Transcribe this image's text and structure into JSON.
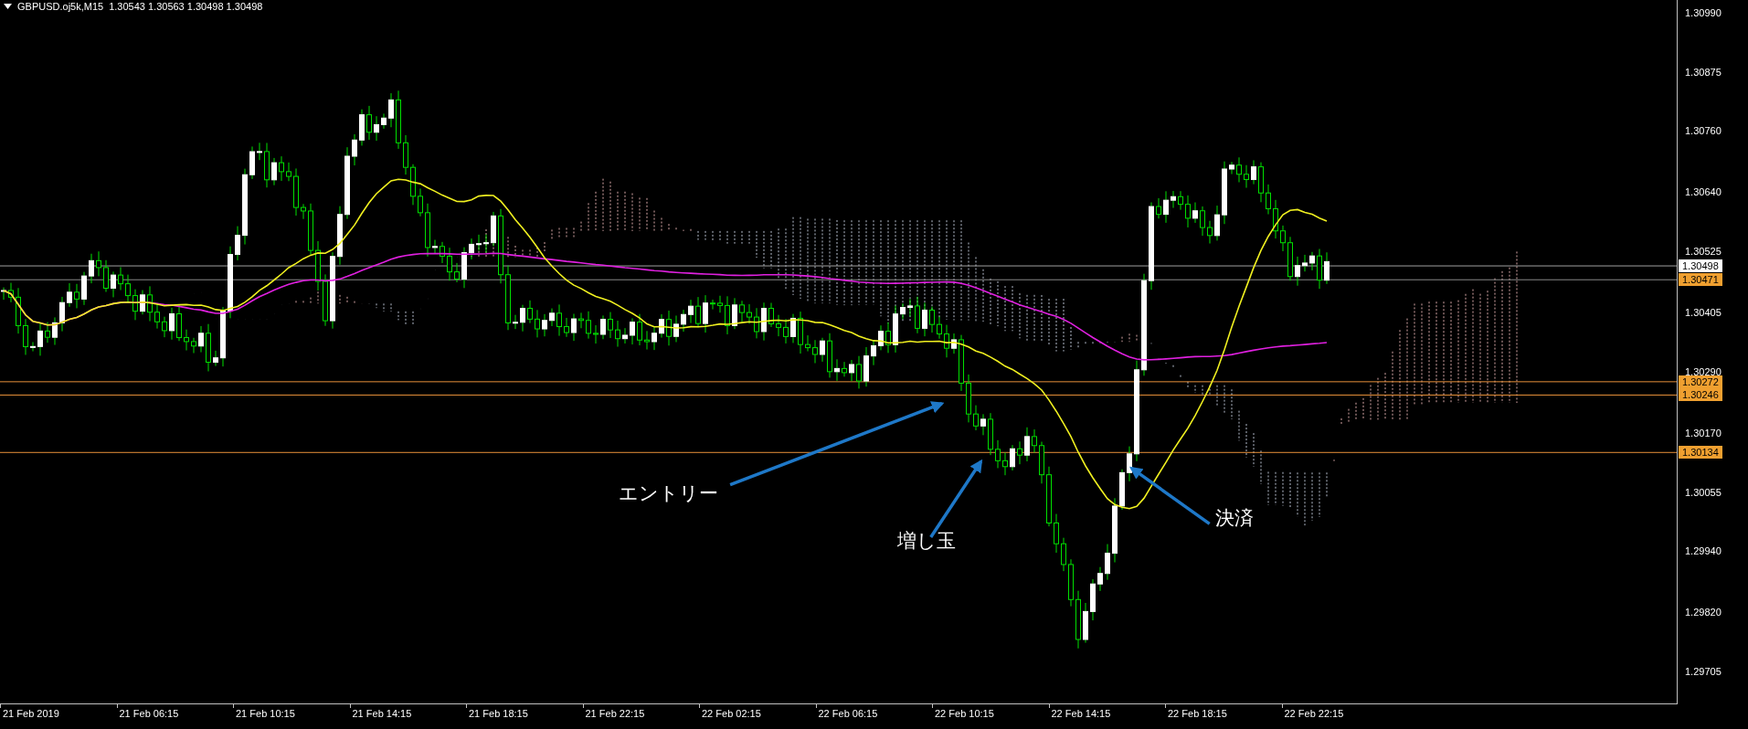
{
  "chart": {
    "header": {
      "symbol": "GBPUSD.oj5k,M15",
      "prices": "1.30543 1.30563 1.30498 1.30498"
    },
    "price_axis": [
      "1.30990",
      "1.30875",
      "1.30760",
      "1.30640",
      "1.30525",
      "1.30405",
      "1.30290",
      "1.30170",
      "1.30055",
      "1.29940",
      "1.29820",
      "1.29705"
    ],
    "price_markers": [
      {
        "label": "1.30498",
        "kind": "bid"
      },
      {
        "label": "1.30471",
        "kind": "ask"
      },
      {
        "label": "1.30272",
        "kind": "level"
      },
      {
        "label": "1.30246",
        "kind": "level"
      },
      {
        "label": "1.30134",
        "kind": "level"
      }
    ],
    "time_axis": [
      "21 Feb 2019",
      "21 Feb 06:15",
      "21 Feb 10:15",
      "21 Feb 14:15",
      "21 Feb 18:15",
      "21 Feb 22:15",
      "22 Feb 02:15",
      "22 Feb 06:15",
      "22 Feb 10:15",
      "22 Feb 14:15",
      "22 Feb 18:15",
      "22 Feb 22:15"
    ],
    "annotations": [
      {
        "text": "エントリー"
      },
      {
        "text": "増し玉"
      },
      {
        "text": "決済"
      }
    ]
  }
}
